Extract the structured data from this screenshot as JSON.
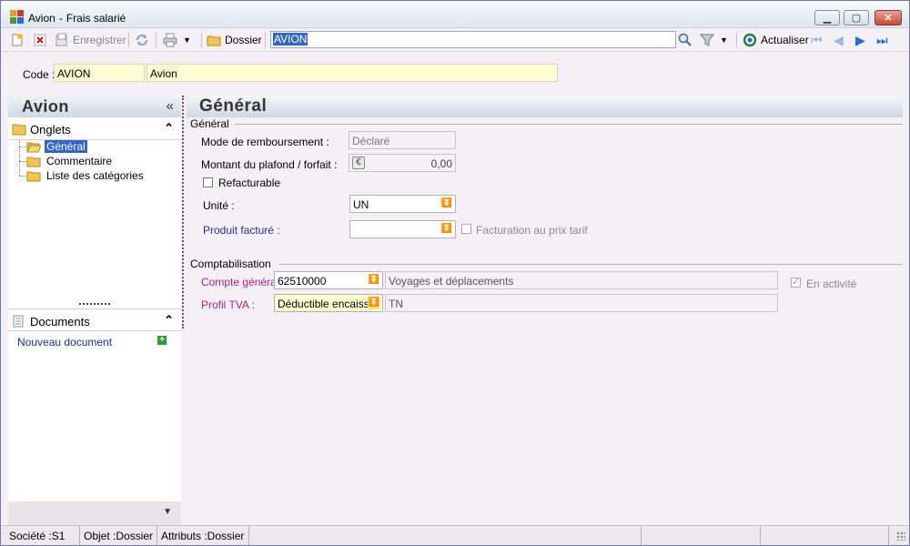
{
  "window": {
    "title": "Avion",
    "title_sep": "-",
    "subtitle": "Frais salarié",
    "minimize_glyph": "▁",
    "maximize_glyph": "▢",
    "close_glyph": "✕"
  },
  "toolbar": {
    "new_icon": "new-document-icon",
    "delete_icon": "delete-icon",
    "save_label": "Enregistrer",
    "refresh_icon": "sync-icon",
    "print_icon": "printer-icon",
    "dossier_label": "Dossier",
    "search_value": "AVION",
    "search_icon": "magnifier-icon",
    "filter_icon": "funnel-icon",
    "refresh_label": "Actualiser",
    "nav": [
      "first",
      "previous",
      "next",
      "last"
    ]
  },
  "code": {
    "label": "Code :",
    "value": "AVION",
    "description": "Avion"
  },
  "left_panel": {
    "title": "Avion",
    "collapse_glyph": "«",
    "onglets_label": "Onglets",
    "onglets_items": [
      {
        "label": "Général",
        "selected": true
      },
      {
        "label": "Commentaire",
        "selected": false
      },
      {
        "label": "Liste des catégories",
        "selected": false
      }
    ],
    "documents_label": "Documents",
    "new_document_label": "Nouveau document",
    "chev_up": "⌃",
    "chev_down": "▾"
  },
  "main": {
    "title": "Général",
    "general_group": "Général",
    "mode_label": "Mode de remboursement :",
    "mode_value": "Déclaré",
    "plafond_label": "Montant du plafond / forfait :",
    "plafond_value": "0,00",
    "refacturable_label": "Refacturable",
    "refacturable_checked": false,
    "unite_label": "Unité :",
    "unite_value": "UN",
    "produit_label": "Produit facturé :",
    "produit_value": "",
    "facturation_label": "Facturation au prix tarif",
    "facturation_checked": false,
    "compta_group": "Comptabilisation",
    "compte_label": "Compte général :",
    "compte_value": "62510000",
    "compte_description": "Voyages et déplacements",
    "en_activite_label": "En activité",
    "en_activite_checked": true,
    "tva_label": "Profil TVA :",
    "tva_value": "Déductible encaiss",
    "tva_code": "TN"
  },
  "statusbar": {
    "societe": "Société :S1",
    "objet": "Objet :Dossier",
    "attributs": "Attributs :Dossier"
  },
  "colors": {
    "accent": "#3166c2",
    "field_yellow": "#fefdd1",
    "link_blue": "#24309a",
    "magenta_label": "#b0208c",
    "background": "#f5f0f5"
  }
}
